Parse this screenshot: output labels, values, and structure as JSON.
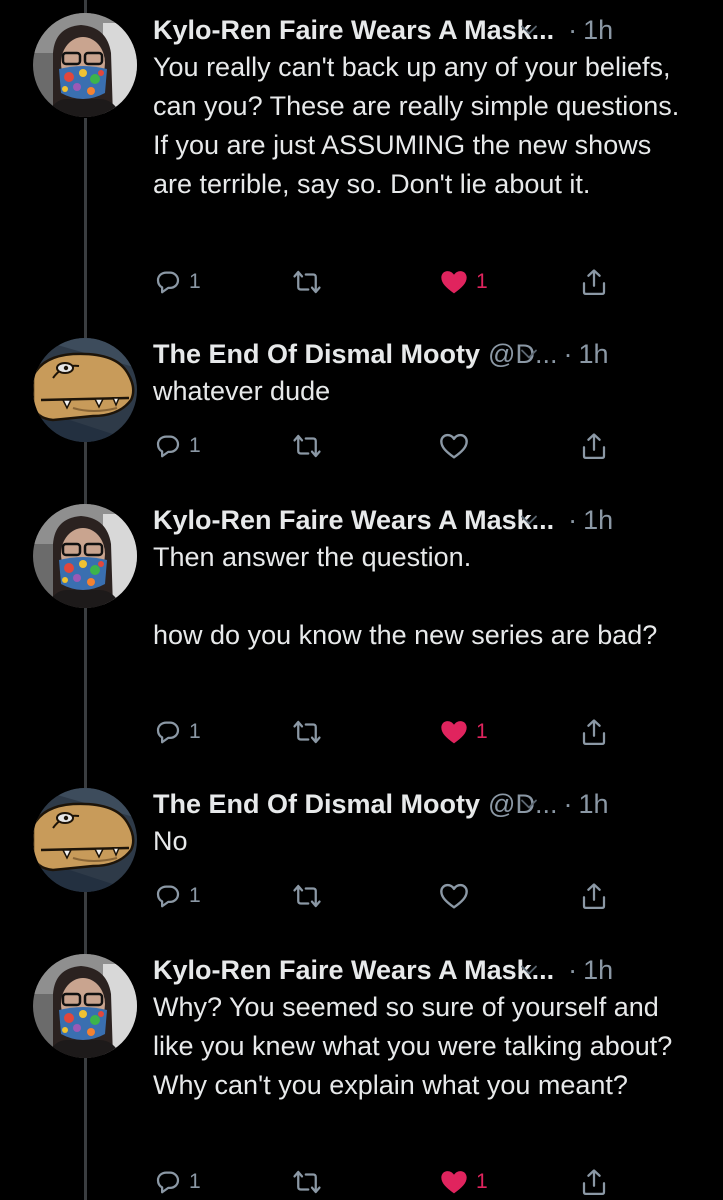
{
  "colors": {
    "background": "#000000",
    "text": "#e7e9ea",
    "secondary": "#8b98a5",
    "like": "#e0245e",
    "thread_line": "#3a3d40"
  },
  "tweets": [
    {
      "name": "Kylo-Ren Faire Wears A Mask...",
      "handle": "",
      "dot": "·",
      "time": "1h",
      "text": "You really can't back up any of your beliefs, can you? These are really simple questions. If you are just ASSUMING the new shows are terrible, say so. Don't lie about it.",
      "reply_count": "1",
      "like_count": "1",
      "liked": true,
      "avatar_icon": "masked-person-avatar"
    },
    {
      "name": "The End Of Dismal Mooty",
      "handle": "@D...",
      "dot": "·",
      "time": "1h",
      "text": "whatever dude",
      "reply_count": "1",
      "like_count": "",
      "liked": false,
      "avatar_icon": "dinosaur-avatar"
    },
    {
      "name": "Kylo-Ren Faire Wears A Mask...",
      "handle": "",
      "dot": "·",
      "time": "1h",
      "text": "Then answer the question.\n\nhow do you know the new series are bad?",
      "reply_count": "1",
      "like_count": "1",
      "liked": true,
      "avatar_icon": "masked-person-avatar"
    },
    {
      "name": "The End Of Dismal Mooty",
      "handle": "@D...",
      "dot": "·",
      "time": "1h",
      "text": "No",
      "reply_count": "1",
      "like_count": "",
      "liked": false,
      "avatar_icon": "dinosaur-avatar"
    },
    {
      "name": "Kylo-Ren Faire Wears A Mask...",
      "handle": "",
      "dot": "·",
      "time": "1h",
      "text": "Why? You seemed so sure of yourself and like you knew what you were talking about? Why can't you explain what you meant?",
      "reply_count": "1",
      "like_count": "1",
      "liked": true,
      "avatar_icon": "masked-person-avatar"
    }
  ]
}
